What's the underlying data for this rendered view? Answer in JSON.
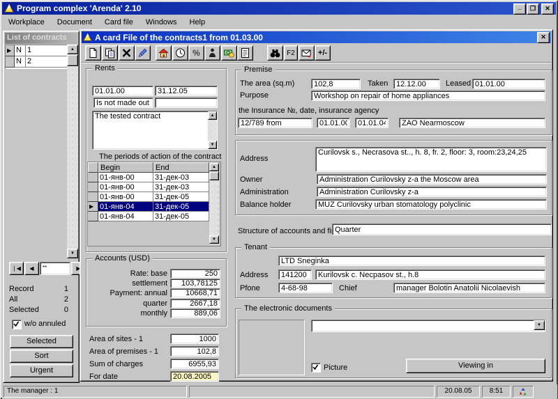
{
  "window": {
    "title": "Program complex 'Arenda' 2.10"
  },
  "menu": {
    "items": [
      "Workplace",
      "Document",
      "Card file",
      "Windows",
      "Help"
    ]
  },
  "list": {
    "title": "List of contracts",
    "rows": [
      {
        "c": "N",
        "v": "1"
      },
      {
        "c": "N",
        "v": "2"
      }
    ],
    "nav_box": "**",
    "record_label": "Record",
    "record_value": "1",
    "all_label": "All",
    "all_value": "2",
    "selected_label": "Selected",
    "selected_value": "0",
    "annuled_label": "w/o annuled",
    "btn_selected": "Selected",
    "btn_sort": "Sort",
    "btn_urgent": "Urgent"
  },
  "card": {
    "title": "A card File of the contracts1 from 01.03.00",
    "f2": "F2",
    "plusminus": "+/-",
    "rents": {
      "legend": "Rents",
      "date_from": "01.01.00",
      "date_to": "31.12.05",
      "status": "Is not made out",
      "status2": "",
      "note": "The tested contract",
      "periods_label": "The periods of action of the contract",
      "col_begin": "Begin",
      "col_end": "End",
      "rows": [
        {
          "b": "01-янв-00",
          "e": "31-дек-03"
        },
        {
          "b": "01-янв-00",
          "e": "31-дек-03"
        },
        {
          "b": "01-янв-00",
          "e": "31-дек-05"
        },
        {
          "b": "01-янв-04",
          "e": "31-дек-05"
        },
        {
          "b": "01-янв-04",
          "e": "31-дек-05"
        }
      ]
    },
    "accounts": {
      "legend": "Accounts (USD)",
      "rows": [
        {
          "label": "Rate: base",
          "value": "250"
        },
        {
          "label": "settlement",
          "value": "103,78125"
        },
        {
          "label": "Payment: annual",
          "value": "10668,71"
        },
        {
          "label": "quarter",
          "value": "2667,18"
        },
        {
          "label": "monthly",
          "value": "889,06"
        }
      ]
    },
    "totals": [
      {
        "label": "Area of sites - 1",
        "value": "1000"
      },
      {
        "label": "Area of premises - 1",
        "value": "102,8"
      },
      {
        "label": "Sum of charges",
        "value": "6955,93"
      },
      {
        "label": "For date",
        "value": "20.08.2005"
      }
    ],
    "premise": {
      "legend": "Premise",
      "area_label": "The area (sq.m)",
      "area": "102,8",
      "taken_label": "Taken",
      "taken": "12.12.00",
      "leased_label": "Leased",
      "leased": "01.01.00",
      "purpose_label": "Purpose",
      "purpose": "Workshop on repair of home appliances",
      "insurance_label": "the Insurance №, date, insurance agency",
      "insurance_no": "12/789 from",
      "insurance_date1": "01.01.00",
      "insurance_date2": "01.01.04",
      "insurance_agency": "ZAO Nearmoscow"
    },
    "location": {
      "address_label": "Address",
      "address": "Curilovsk s., Necrasova st.., h. 8, fr. 2, floor: 3, room:23,24,25",
      "owner_label": "Owner",
      "owner": "Administration Curilovsky z-a the Moscow area",
      "administration_label": "Administration",
      "administration": "Administration Curilovsky z-a",
      "balance_label": "Balance holder",
      "balance": "MUZ Curilovsky urban stomatology polyclinic"
    },
    "structure": {
      "label": "Structure of accounts and fir",
      "value": "Quarter"
    },
    "tenant": {
      "legend": "Tenant",
      "name": "LTD Sneginka",
      "address_label": "Address",
      "postcode": "141200",
      "address": "Kurilovsk c. Necpasov st., h.8",
      "phone_label": "Pfone",
      "phone": "4-68-98",
      "chief_label": "Chief",
      "chief": "manager Bolotin Anatolii Nicolaevish"
    },
    "edocs": {
      "legend": "The electronic documents",
      "picture": "Picture",
      "viewing": "Viewing in"
    }
  },
  "statusbar": {
    "manager": "The manager : 1",
    "date": "20.08.05",
    "time": "8:51"
  }
}
